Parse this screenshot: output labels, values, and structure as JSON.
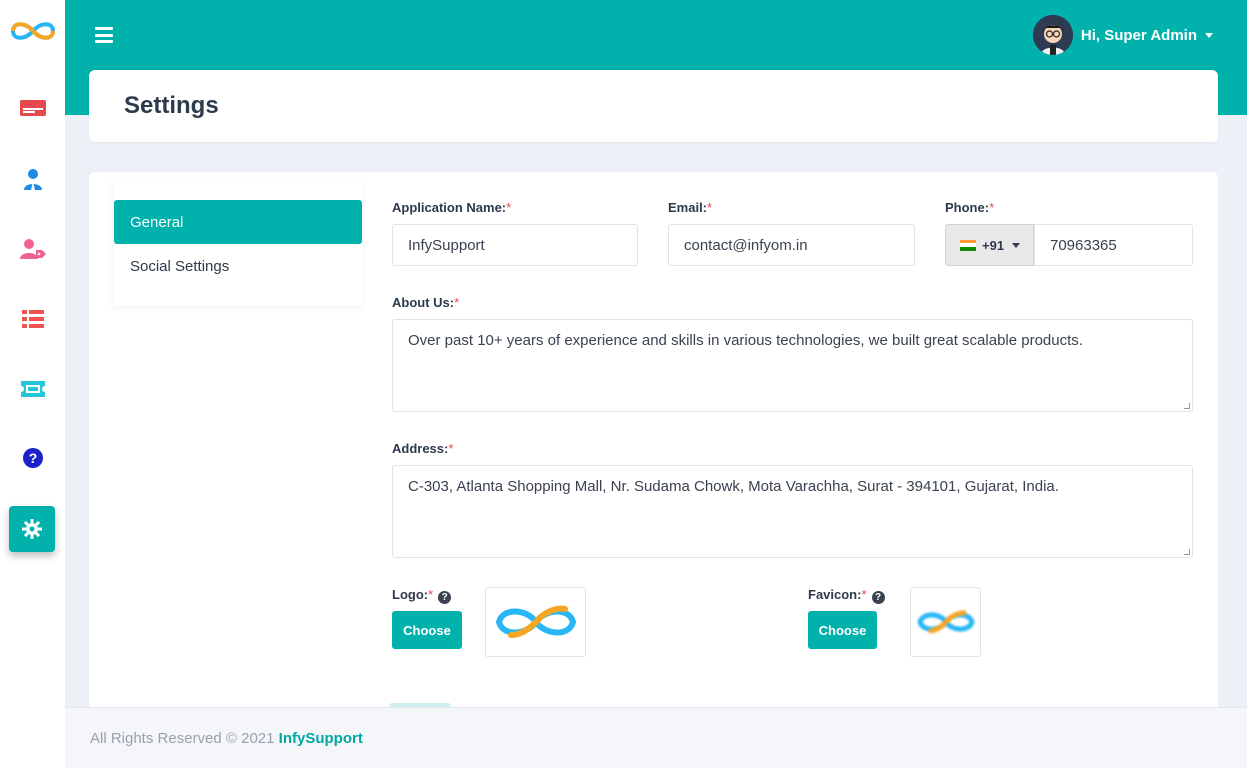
{
  "sidebar": {
    "items": [
      {
        "icon": "id-card-icon",
        "color": "#e5484d"
      },
      {
        "icon": "user-tie-icon",
        "color": "#1e88e5"
      },
      {
        "icon": "user-tag-icon",
        "color": "#f06292"
      },
      {
        "icon": "list-icon",
        "color": "#ef5350"
      },
      {
        "icon": "ticket-icon",
        "color": "#26c6da"
      },
      {
        "icon": "question-circle-icon",
        "color": "#1a23c9"
      },
      {
        "icon": "gear-icon",
        "color": "#ffffff",
        "active": true
      }
    ]
  },
  "header": {
    "user_greeting": "Hi, Super Admin"
  },
  "page": {
    "title": "Settings"
  },
  "tabs": [
    {
      "label": "General",
      "active": true
    },
    {
      "label": "Social Settings",
      "active": false
    }
  ],
  "form": {
    "app_name": {
      "label": "Application Name:",
      "value": "InfySupport"
    },
    "email": {
      "label": "Email:",
      "value": "contact@infyom.in"
    },
    "phone": {
      "label": "Phone:",
      "country_code": "+91",
      "value": "70963365"
    },
    "about": {
      "label": "About Us:",
      "value": "Over past 10+ years of experience and skills in various technologies, we built great scalable products."
    },
    "address": {
      "label": "Address:",
      "value": "C-303, Atlanta Shopping Mall, Nr. Sudama Chowk, Mota Varachha, Surat - 394101, Gujarat, India."
    },
    "logo": {
      "label": "Logo:",
      "button": "Choose"
    },
    "favicon": {
      "label": "Favicon:",
      "button": "Choose"
    },
    "required_mark": "*",
    "help_glyph": "?"
  },
  "footer": {
    "text": "All Rights Reserved © 2021",
    "brand": "InfySupport"
  },
  "colors": {
    "primary": "#00b1ac",
    "required": "#e5484d",
    "background": "#eef0f8"
  }
}
